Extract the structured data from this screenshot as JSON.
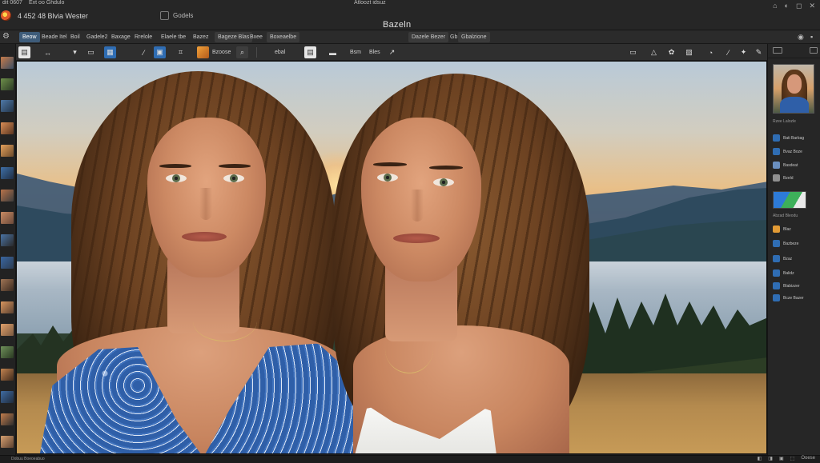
{
  "titlebar": {
    "top_left": "dit 0607",
    "top_left2": "Ext oo Ghdulo",
    "top_mid": "Atloozt idsuz",
    "doc_info": "4 452 48 Blvia Wester",
    "edit_label": "Godels",
    "app_title": "Bazeln",
    "window_icons": [
      "⌂",
      "◐",
      "◻",
      "✕"
    ]
  },
  "menubar": {
    "items": [
      {
        "label": "Beow",
        "active": true
      },
      {
        "label": "Beade Itel",
        "active": false
      },
      {
        "label": "Boil",
        "active": false
      },
      {
        "label": "Gadele2",
        "active": false
      },
      {
        "label": "Baxage",
        "active": false
      },
      {
        "label": "Rrelole",
        "active": false
      },
      {
        "label": "Elaele tbe",
        "active": false
      },
      {
        "label": "Bazez",
        "active": false
      },
      {
        "label": "Bageze Blas",
        "active": false
      },
      {
        "label": "Bxee",
        "active": false
      },
      {
        "label": "Boxeaelbe",
        "active": false
      }
    ],
    "right_items": [
      {
        "label": "Dazele Bezer"
      },
      {
        "label": "Gb"
      },
      {
        "label": "Gbalzione"
      }
    ]
  },
  "optbar": {
    "items": [
      "Bzoose",
      "ebal",
      "Bsm",
      "Bles"
    ],
    "tool_icons": [
      "layers-icon",
      "move-icon",
      "crop-icon",
      "brush-icon",
      "frame-icon"
    ]
  },
  "rightpanel": {
    "preview_caption": "Rzee Lalozle",
    "layers": [
      {
        "label": "Bati Barbag",
        "color": "blue"
      },
      {
        "label": "Bvaz Boze",
        "color": "blue"
      },
      {
        "label": "Basdeat",
        "color": "lt"
      },
      {
        "label": "Bzeld",
        "color": "gr"
      }
    ],
    "section2_caption": "Abzad Bleodu",
    "tools": [
      {
        "label": "Blaz",
        "color": "or"
      },
      {
        "label": "Bazbeze",
        "color": "blue"
      },
      {
        "label": "Bzaz",
        "color": "blue"
      },
      {
        "label": "Balidz",
        "color": "blue"
      },
      {
        "label": "Blabizzer",
        "color": "blue"
      },
      {
        "label": "Bcze Bazer",
        "color": "blue"
      }
    ]
  },
  "statusbar": {
    "left": "Dobuu Boeoeabuo",
    "right_icons": [
      "◧",
      "◨",
      "▣",
      "⬚",
      "Ooese"
    ]
  },
  "colors": {
    "accent": "#3e5c7a",
    "primary_blue": "#2f6db3",
    "panel_bg": "#262626"
  }
}
